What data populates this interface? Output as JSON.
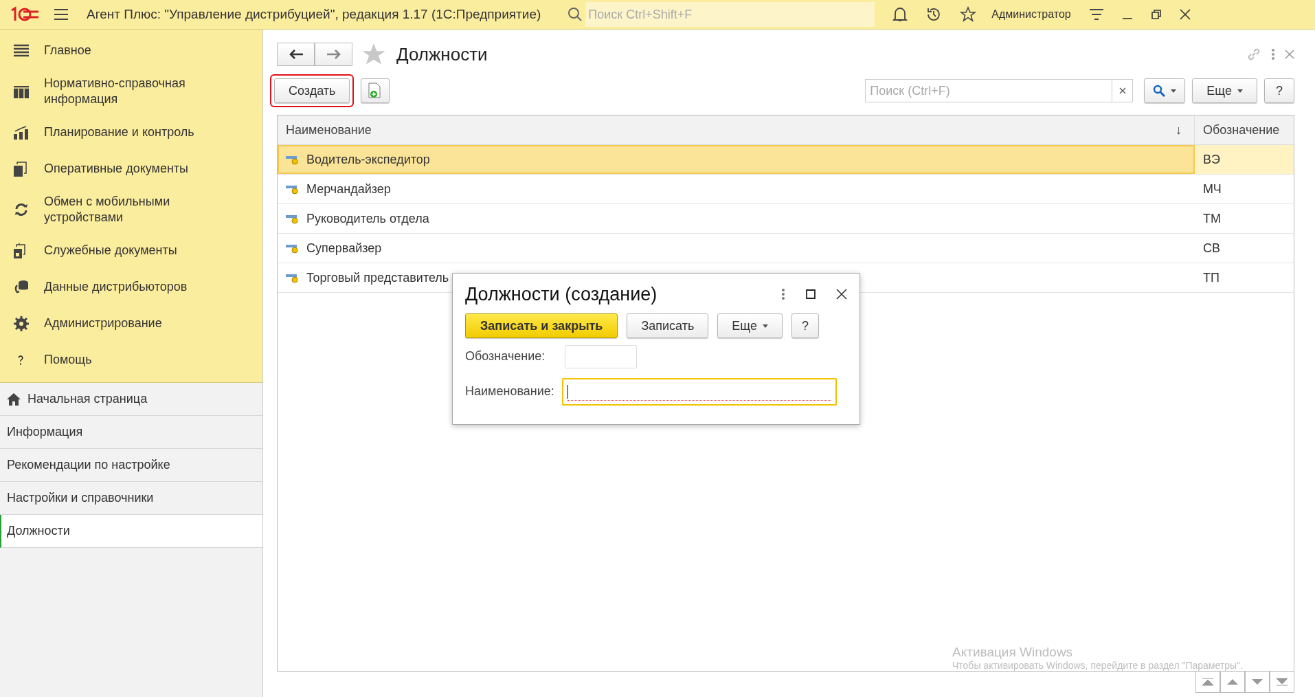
{
  "app": {
    "title": "Агент Плюс: \"Управление дистрибуцией\", редакция 1.17  (1С:Предприятие)",
    "search": {
      "placeholder": "Поиск Ctrl+Shift+F"
    },
    "user": "Администратор"
  },
  "sections": [
    {
      "label": "Главное"
    },
    {
      "label": "Нормативно-справочная информация"
    },
    {
      "label": "Планирование и контроль"
    },
    {
      "label": "Оперативные документы"
    },
    {
      "label": "Обмен с мобильными устройствами"
    },
    {
      "label": "Служебные документы"
    },
    {
      "label": "Данные дистрибьюторов"
    },
    {
      "label": "Администрирование"
    },
    {
      "label": "Помощь"
    }
  ],
  "open_pages": [
    {
      "label": "Начальная страница",
      "selected": false
    },
    {
      "label": "Информация",
      "selected": false
    },
    {
      "label": "Рекомендации по настройке",
      "selected": false
    },
    {
      "label": "Настройки и справочники",
      "selected": false
    },
    {
      "label": "Должности",
      "selected": true
    }
  ],
  "form": {
    "title": "Должности",
    "create_button": {
      "label": "Создать",
      "highlighted": true
    },
    "search": {
      "placeholder": "Поиск (Ctrl+F)"
    },
    "more_button": "Еще",
    "help_button": "?"
  },
  "table": {
    "columns": [
      {
        "label": "Наименование",
        "sort_mark": "↓"
      },
      {
        "label": "Обозначение"
      }
    ],
    "rows": [
      {
        "name": "Водитель-экспедитор",
        "code": "ВЭ",
        "selected": true
      },
      {
        "name": "Мерчандайзер",
        "code": "МЧ",
        "selected": false
      },
      {
        "name": "Руководитель отдела",
        "code": "ТМ",
        "selected": false
      },
      {
        "name": "Супервайзер",
        "code": "СВ",
        "selected": false
      },
      {
        "name": "Торговый представитель",
        "code": "ТП",
        "selected": false
      }
    ]
  },
  "dialog": {
    "title": "Должности (создание)",
    "buttons": [
      {
        "label": "Записать и закрыть",
        "kind": "primary"
      },
      {
        "label": "Записать",
        "kind": "plain"
      },
      {
        "label": "Еще",
        "kind": "menu"
      },
      {
        "label": "?",
        "kind": "plain"
      }
    ],
    "fields": [
      {
        "label": "Обозначение:",
        "kind": "short",
        "focused": false,
        "required": false
      },
      {
        "label": "Наименование:",
        "kind": "long",
        "focused": true,
        "required": true
      }
    ]
  },
  "watermark": {
    "title": "Активация Windows",
    "text": "Чтобы активировать Windows, перейдите в раздел \"Параметры\"."
  }
}
